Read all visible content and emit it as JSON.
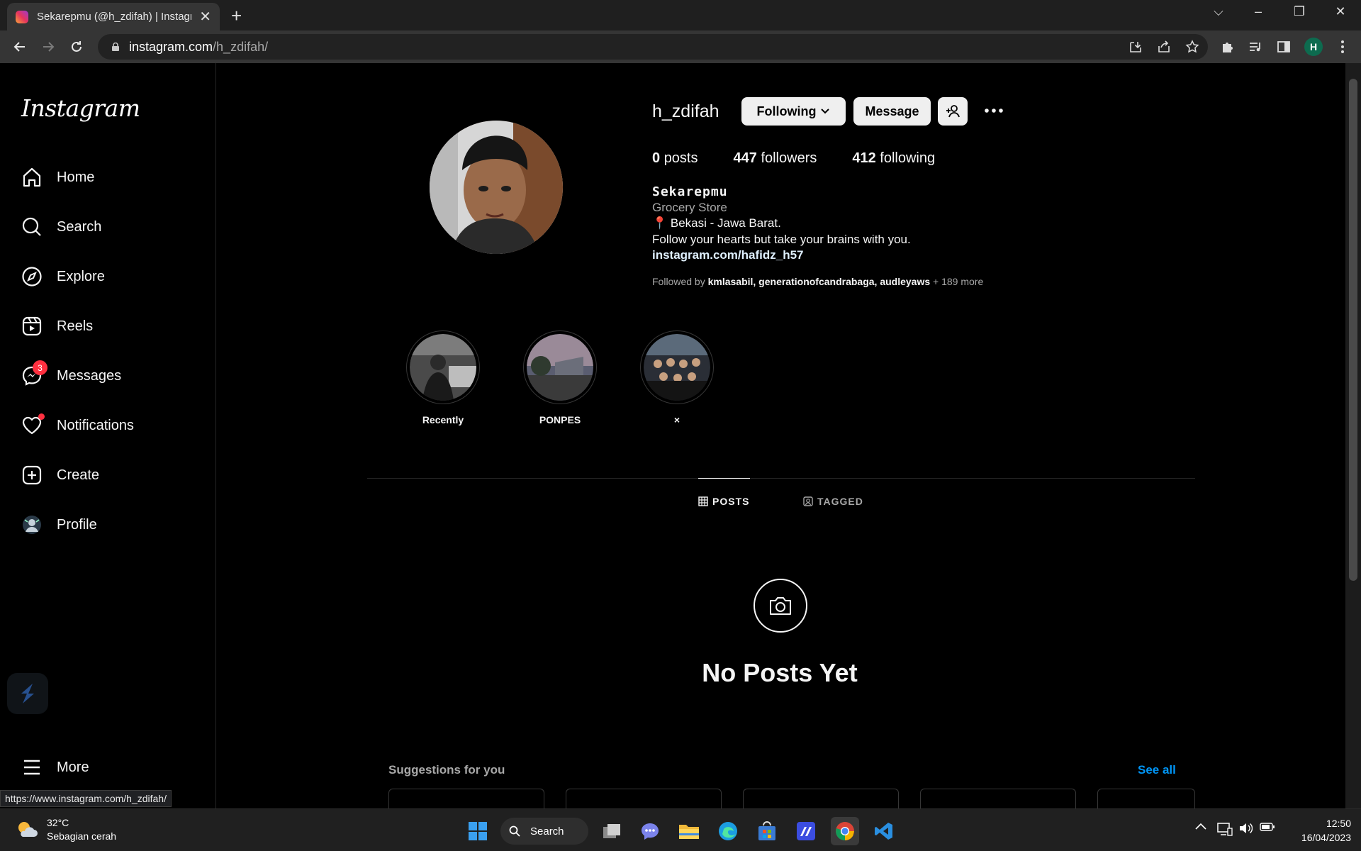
{
  "browser": {
    "tab_title": "Sekarepmu (@h_zdifah) | Instagram",
    "tab_close": "✕",
    "new_tab": "+",
    "window_controls": {
      "tabsearch": "⌵",
      "minimize": "–",
      "restore": "❐",
      "close": "✕"
    },
    "url_host": "instagram.com",
    "url_path": "/h_zdifah/",
    "profile_initial": "H",
    "status_url": "https://www.instagram.com/h_zdifah/"
  },
  "sidebar": {
    "logo": "Instagram",
    "items": [
      {
        "label": "Home",
        "icon": "home-icon"
      },
      {
        "label": "Search",
        "icon": "search-icon"
      },
      {
        "label": "Explore",
        "icon": "compass-icon"
      },
      {
        "label": "Reels",
        "icon": "reels-icon"
      },
      {
        "label": "Messages",
        "icon": "messenger-icon",
        "badge": "3"
      },
      {
        "label": "Notifications",
        "icon": "heart-icon"
      },
      {
        "label": "Create",
        "icon": "plus-square-icon"
      },
      {
        "label": "Profile",
        "icon": "profile-avatar-icon"
      }
    ],
    "more_label": "More"
  },
  "profile": {
    "username": "h_zdifah",
    "following_button": "Following",
    "message_button": "Message",
    "posts_count": "0",
    "posts_label": "posts",
    "followers_count": "447",
    "followers_label": "followers",
    "following_count": "412",
    "following_label": "following",
    "display_name": "Sekarepmu",
    "category": "Grocery Store",
    "bio_location": "📍 Bekasi - Jawa Barat.",
    "bio_quote": "Follow your hearts but take your brains with you.",
    "bio_link": "instagram.com/hafidz_h57",
    "followed_by_prefix": "Followed by",
    "followed_by_names": "kmlasabil, generationofcandrabaga, audleyaws",
    "followed_by_more": "+ 189 more"
  },
  "highlights": [
    {
      "label": "Recently"
    },
    {
      "label": "PONPES"
    },
    {
      "label": "×"
    }
  ],
  "tabs": {
    "posts": "POSTS",
    "tagged": "TAGGED"
  },
  "empty_state": {
    "title": "No Posts Yet"
  },
  "suggestions": {
    "title": "Suggestions for you",
    "see_all": "See all"
  },
  "taskbar": {
    "temperature": "32°C",
    "weather_desc": "Sebagian cerah",
    "search_label": "Search",
    "time": "12:50",
    "date": "16/04/2023"
  }
}
